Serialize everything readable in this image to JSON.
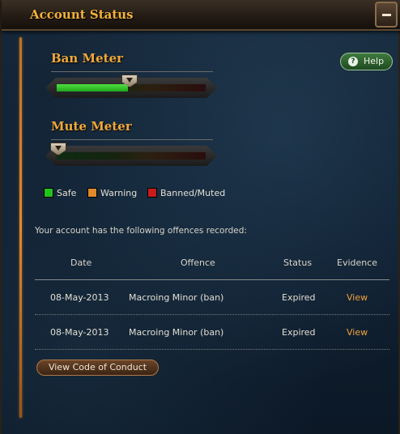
{
  "window": {
    "title": "Account Status"
  },
  "help": {
    "label": "Help"
  },
  "meters": [
    {
      "title": "Ban Meter",
      "level": 0.48
    },
    {
      "title": "Mute Meter",
      "level": 0.0
    }
  ],
  "legend": [
    {
      "label": "Safe",
      "color": "#20c21c"
    },
    {
      "label": "Warning",
      "color": "#e08a2c"
    },
    {
      "label": "Banned/Muted",
      "color": "#c81c1c"
    }
  ],
  "offences": {
    "intro": "Your account has the following offences recorded:",
    "columns": [
      "Date",
      "Offence",
      "Status",
      "Evidence"
    ],
    "rows": [
      {
        "date": "08-May-2013",
        "offence": "Macroing Minor (ban)",
        "status": "Expired",
        "evidence": "View"
      },
      {
        "date": "08-May-2013",
        "offence": "Macroing Minor (ban)",
        "status": "Expired",
        "evidence": "View"
      }
    ]
  },
  "code_of_conduct": {
    "label": "View Code of Conduct"
  }
}
